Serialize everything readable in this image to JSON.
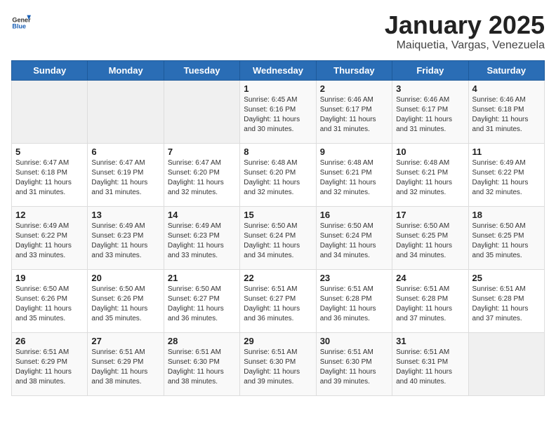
{
  "header": {
    "logo_general": "General",
    "logo_blue": "Blue",
    "title": "January 2025",
    "subtitle": "Maiquetia, Vargas, Venezuela"
  },
  "days_of_week": [
    "Sunday",
    "Monday",
    "Tuesday",
    "Wednesday",
    "Thursday",
    "Friday",
    "Saturday"
  ],
  "weeks": [
    [
      {
        "day": "",
        "sunrise": "",
        "sunset": "",
        "daylight": ""
      },
      {
        "day": "",
        "sunrise": "",
        "sunset": "",
        "daylight": ""
      },
      {
        "day": "",
        "sunrise": "",
        "sunset": "",
        "daylight": ""
      },
      {
        "day": "1",
        "sunrise": "6:45 AM",
        "sunset": "6:16 PM",
        "daylight": "11 hours and 30 minutes."
      },
      {
        "day": "2",
        "sunrise": "6:46 AM",
        "sunset": "6:17 PM",
        "daylight": "11 hours and 31 minutes."
      },
      {
        "day": "3",
        "sunrise": "6:46 AM",
        "sunset": "6:17 PM",
        "daylight": "11 hours and 31 minutes."
      },
      {
        "day": "4",
        "sunrise": "6:46 AM",
        "sunset": "6:18 PM",
        "daylight": "11 hours and 31 minutes."
      }
    ],
    [
      {
        "day": "5",
        "sunrise": "6:47 AM",
        "sunset": "6:18 PM",
        "daylight": "11 hours and 31 minutes."
      },
      {
        "day": "6",
        "sunrise": "6:47 AM",
        "sunset": "6:19 PM",
        "daylight": "11 hours and 31 minutes."
      },
      {
        "day": "7",
        "sunrise": "6:47 AM",
        "sunset": "6:20 PM",
        "daylight": "11 hours and 32 minutes."
      },
      {
        "day": "8",
        "sunrise": "6:48 AM",
        "sunset": "6:20 PM",
        "daylight": "11 hours and 32 minutes."
      },
      {
        "day": "9",
        "sunrise": "6:48 AM",
        "sunset": "6:21 PM",
        "daylight": "11 hours and 32 minutes."
      },
      {
        "day": "10",
        "sunrise": "6:48 AM",
        "sunset": "6:21 PM",
        "daylight": "11 hours and 32 minutes."
      },
      {
        "day": "11",
        "sunrise": "6:49 AM",
        "sunset": "6:22 PM",
        "daylight": "11 hours and 32 minutes."
      }
    ],
    [
      {
        "day": "12",
        "sunrise": "6:49 AM",
        "sunset": "6:22 PM",
        "daylight": "11 hours and 33 minutes."
      },
      {
        "day": "13",
        "sunrise": "6:49 AM",
        "sunset": "6:23 PM",
        "daylight": "11 hours and 33 minutes."
      },
      {
        "day": "14",
        "sunrise": "6:49 AM",
        "sunset": "6:23 PM",
        "daylight": "11 hours and 33 minutes."
      },
      {
        "day": "15",
        "sunrise": "6:50 AM",
        "sunset": "6:24 PM",
        "daylight": "11 hours and 34 minutes."
      },
      {
        "day": "16",
        "sunrise": "6:50 AM",
        "sunset": "6:24 PM",
        "daylight": "11 hours and 34 minutes."
      },
      {
        "day": "17",
        "sunrise": "6:50 AM",
        "sunset": "6:25 PM",
        "daylight": "11 hours and 34 minutes."
      },
      {
        "day": "18",
        "sunrise": "6:50 AM",
        "sunset": "6:25 PM",
        "daylight": "11 hours and 35 minutes."
      }
    ],
    [
      {
        "day": "19",
        "sunrise": "6:50 AM",
        "sunset": "6:26 PM",
        "daylight": "11 hours and 35 minutes."
      },
      {
        "day": "20",
        "sunrise": "6:50 AM",
        "sunset": "6:26 PM",
        "daylight": "11 hours and 35 minutes."
      },
      {
        "day": "21",
        "sunrise": "6:50 AM",
        "sunset": "6:27 PM",
        "daylight": "11 hours and 36 minutes."
      },
      {
        "day": "22",
        "sunrise": "6:51 AM",
        "sunset": "6:27 PM",
        "daylight": "11 hours and 36 minutes."
      },
      {
        "day": "23",
        "sunrise": "6:51 AM",
        "sunset": "6:28 PM",
        "daylight": "11 hours and 36 minutes."
      },
      {
        "day": "24",
        "sunrise": "6:51 AM",
        "sunset": "6:28 PM",
        "daylight": "11 hours and 37 minutes."
      },
      {
        "day": "25",
        "sunrise": "6:51 AM",
        "sunset": "6:28 PM",
        "daylight": "11 hours and 37 minutes."
      }
    ],
    [
      {
        "day": "26",
        "sunrise": "6:51 AM",
        "sunset": "6:29 PM",
        "daylight": "11 hours and 38 minutes."
      },
      {
        "day": "27",
        "sunrise": "6:51 AM",
        "sunset": "6:29 PM",
        "daylight": "11 hours and 38 minutes."
      },
      {
        "day": "28",
        "sunrise": "6:51 AM",
        "sunset": "6:30 PM",
        "daylight": "11 hours and 38 minutes."
      },
      {
        "day": "29",
        "sunrise": "6:51 AM",
        "sunset": "6:30 PM",
        "daylight": "11 hours and 39 minutes."
      },
      {
        "day": "30",
        "sunrise": "6:51 AM",
        "sunset": "6:30 PM",
        "daylight": "11 hours and 39 minutes."
      },
      {
        "day": "31",
        "sunrise": "6:51 AM",
        "sunset": "6:31 PM",
        "daylight": "11 hours and 40 minutes."
      },
      {
        "day": "",
        "sunrise": "",
        "sunset": "",
        "daylight": ""
      }
    ]
  ],
  "labels": {
    "sunrise": "Sunrise:",
    "sunset": "Sunset:",
    "daylight": "Daylight:"
  }
}
